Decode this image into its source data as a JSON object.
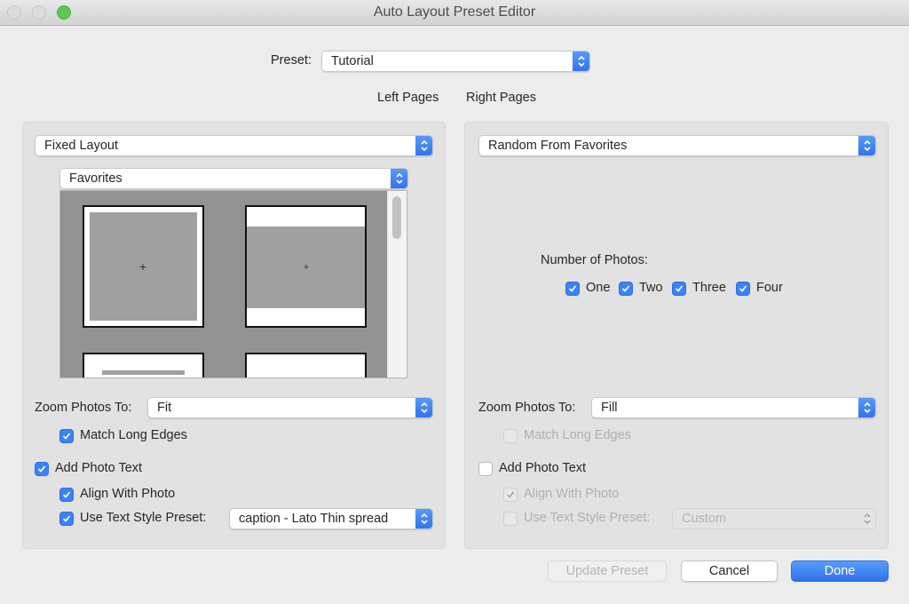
{
  "window": {
    "title": "Auto Layout Preset Editor"
  },
  "preset": {
    "label": "Preset:",
    "value": "Tutorial"
  },
  "headers": {
    "left": "Left Pages",
    "right": "Right Pages"
  },
  "left": {
    "layout_mode": "Fixed Layout",
    "layout_source": "Favorites",
    "thumbnail_add_glyph": "+",
    "zoom_label": "Zoom Photos To:",
    "zoom_value": "Fit",
    "match_long_edges": {
      "label": "Match Long Edges",
      "checked": true,
      "enabled": true
    },
    "add_photo_text": {
      "label": "Add Photo Text",
      "checked": true,
      "enabled": true
    },
    "align_with_photo": {
      "label": "Align With Photo",
      "checked": true,
      "enabled": true
    },
    "use_text_style": {
      "label": "Use Text Style Preset:",
      "checked": true,
      "enabled": true
    },
    "text_style_value": "caption - Lato Thin spread"
  },
  "right": {
    "layout_mode": "Random From Favorites",
    "number_of_photos_label": "Number of Photos:",
    "number_options": [
      {
        "label": "One",
        "checked": true
      },
      {
        "label": "Two",
        "checked": true
      },
      {
        "label": "Three",
        "checked": true
      },
      {
        "label": "Four",
        "checked": true
      }
    ],
    "zoom_label": "Zoom Photos To:",
    "zoom_value": "Fill",
    "match_long_edges": {
      "label": "Match Long Edges",
      "checked": false,
      "enabled": false
    },
    "add_photo_text": {
      "label": "Add Photo Text",
      "checked": false,
      "enabled": true
    },
    "align_with_photo": {
      "label": "Align With Photo",
      "checked": true,
      "enabled": false
    },
    "use_text_style": {
      "label": "Use Text Style Preset:",
      "checked": false,
      "enabled": false
    },
    "text_style_value": "Custom"
  },
  "buttons": {
    "update": "Update Preset",
    "cancel": "Cancel",
    "done": "Done"
  },
  "colors": {
    "accent": "#3b82f6",
    "zoom_traffic_light": "#5bc84f"
  }
}
